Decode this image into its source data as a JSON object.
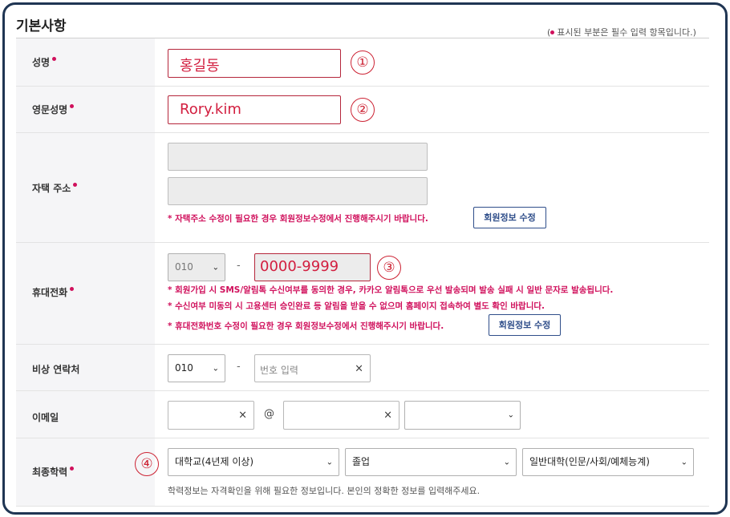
{
  "section": {
    "title": "기본사항",
    "required_note": "표시된 부분은 필수 입력 항목입니다.",
    "required_note_open": "(",
    "required_note_close": ")"
  },
  "rows": {
    "name": {
      "label": "성명",
      "value": "홍길동",
      "marker": "①"
    },
    "eng_name": {
      "label": "영문성명",
      "value": "Rory.kim",
      "marker": "②"
    },
    "address": {
      "label": "자택 주소",
      "warning": "* 자택주소 수정이 필요한 경우 회원정보수정에서 진행해주시기 바랍니다.",
      "button": "회원정보 수정"
    },
    "mobile": {
      "label": "휴대전화",
      "prefix": "010",
      "separator": "-",
      "value": "0000-9999",
      "marker": "③",
      "warning1": "* 회원가입 시 SMS/알림톡 수신여부를 동의한 경우, 카카오 알림톡으로 우선 발송되며 발송 실패 시 일반 문자로 발송됩니다.",
      "warning2": "* 수신여부 미동의 시 고용센터 승인완료 등 알림을 받을 수 없으며 홈페이지 접속하여 별도 확인 바랍니다.",
      "warning3": "* 휴대전화번호 수정이 필요한 경우 회원정보수정에서 진행해주시기 바랍니다.",
      "button": "회원정보 수정"
    },
    "emergency": {
      "label": "비상 연락처",
      "prefix": "010",
      "separator": "-",
      "placeholder": "번호 입력"
    },
    "email": {
      "label": "이메일",
      "at": "@",
      "domain_value": ""
    },
    "education": {
      "label": "최종학력",
      "marker": "④",
      "level": "대학교(4년제 이상)",
      "status": "졸업",
      "field": "일반대학(인문/사회/예체능계)",
      "help": "학력정보는 자격확인을 위해 필요한 정보입니다. 본인의 정확한 정보를 입력해주세요."
    }
  },
  "icons": {
    "clear": "×",
    "chevron": "⌄"
  },
  "colors": {
    "required": "#d0105c",
    "highlight": "#cc2233",
    "frame": "#1f3553",
    "button": "#2f4e8a"
  }
}
